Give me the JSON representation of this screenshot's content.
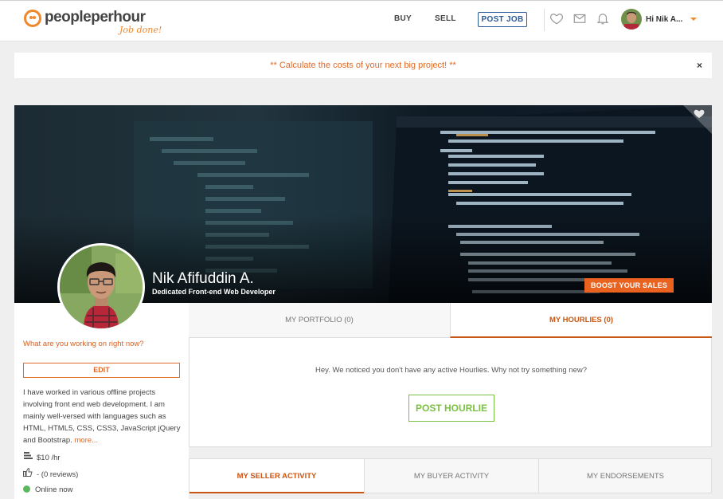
{
  "header": {
    "logo_text": "peopleperhour",
    "logo_tagline": "Job done!",
    "nav": {
      "buy": "BUY",
      "sell": "SELL",
      "post_job": "POST JOB"
    },
    "user_greeting": "Hi Nik A..."
  },
  "promo": {
    "text": "** Calculate the costs of your next big project! **",
    "close": "×"
  },
  "profile": {
    "name": "Nik Afifuddin A.",
    "title": "Dedicated Front-end Web Developer",
    "boost_label": "BOOST YOUR SALES"
  },
  "sidebar": {
    "working_prompt": "What are you working on right now?",
    "edit_label": "EDIT",
    "bio": "I have worked in various offline projects involving front end web development. I am mainly well-versed with languages such as HTML, HTML5, CSS, CSS3, JavaScript jQuery and Bootstrap.",
    "more_label": "more...",
    "rate": "$10 /hr",
    "reviews": "- (0 reviews)",
    "status": "Online now"
  },
  "tabs": {
    "portfolio": "MY PORTFOLIO (0)",
    "hourlies": "MY HOURLIES (0)"
  },
  "hourlies": {
    "empty_message": "Hey. We noticed you don't have any active Hourlies. Why not try something new?",
    "post_label": "POST HOURLIE"
  },
  "activity_tabs": {
    "seller": "MY SELLER ACTIVITY",
    "buyer": "MY BUYER ACTIVITY",
    "endorsements": "MY ENDORSEMENTS"
  },
  "colors": {
    "accent_orange": "#e9621f",
    "link_orange": "#e06a26",
    "post_job_blue": "#2a5a9c",
    "hourlie_green": "#7ac142",
    "online_green": "#5cb85c"
  },
  "icons": [
    "heart-icon",
    "mail-icon",
    "bell-icon",
    "money-icon",
    "thumbs-up-icon",
    "online-dot-icon",
    "close-icon",
    "caret-down-icon"
  ]
}
